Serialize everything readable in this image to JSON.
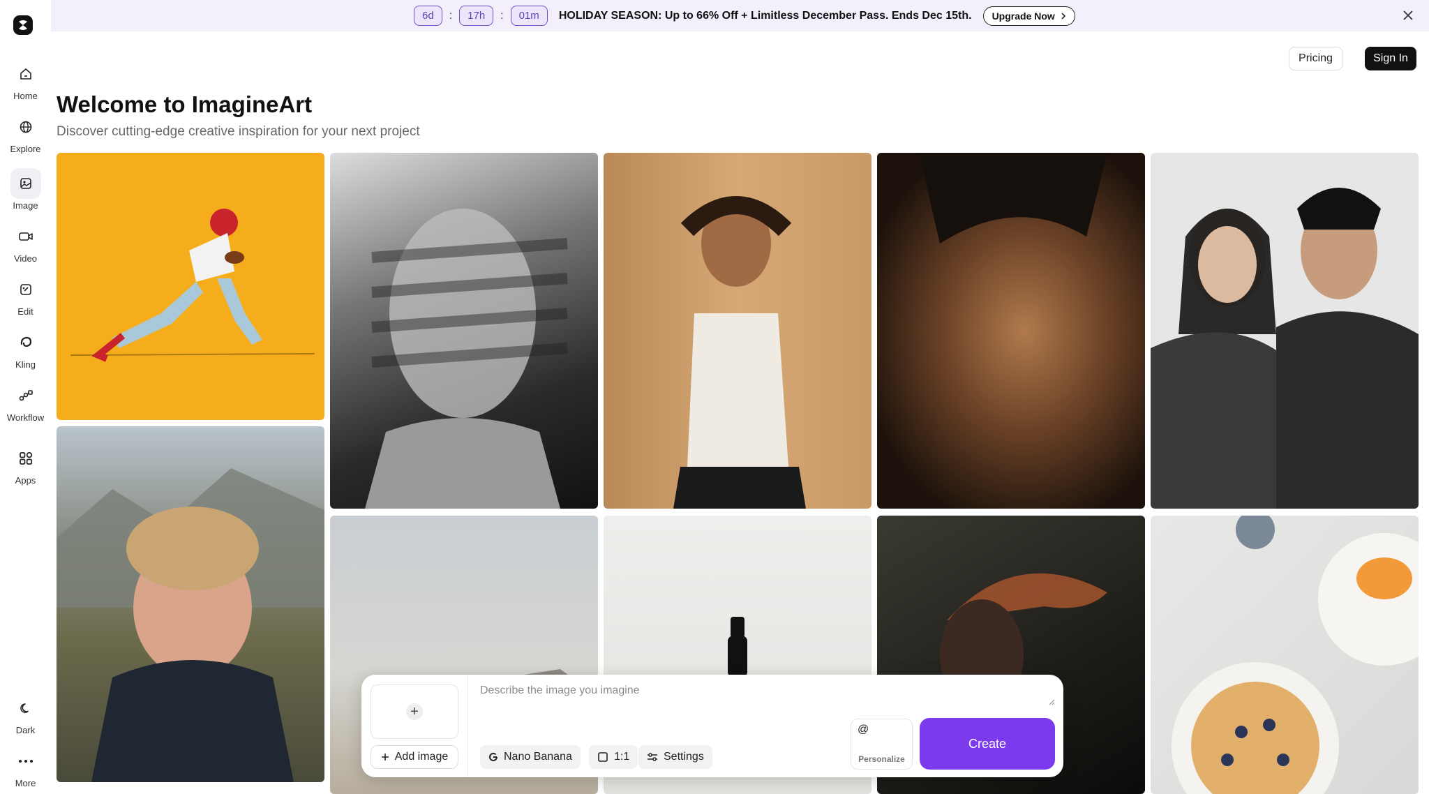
{
  "banner": {
    "countdown": {
      "days": "6d",
      "hours": "17h",
      "minutes": "01m"
    },
    "separator": ":",
    "promo_text": "HOLIDAY SEASON: Up to 66% Off + Limitless December Pass. Ends Dec 15th.",
    "upgrade_label": "Upgrade Now"
  },
  "header": {
    "pricing_label": "Pricing",
    "signin_label": "Sign In"
  },
  "sidebar": {
    "items": [
      {
        "label": "Home",
        "icon": "home-icon"
      },
      {
        "label": "Explore",
        "icon": "globe-icon"
      },
      {
        "label": "Image",
        "icon": "image-icon",
        "active": true
      },
      {
        "label": "Video",
        "icon": "video-icon"
      },
      {
        "label": "Edit",
        "icon": "edit-icon"
      },
      {
        "label": "Kling",
        "icon": "kling-icon"
      },
      {
        "label": "Workflow",
        "icon": "workflow-icon"
      },
      {
        "label": "Apps",
        "icon": "apps-icon"
      }
    ],
    "bottom": [
      {
        "label": "Dark",
        "icon": "moon-icon"
      },
      {
        "label": "More",
        "icon": "more-icon"
      }
    ]
  },
  "main": {
    "title": "Welcome to ImagineArt",
    "subtitle": "Discover cutting-edge creative inspiration for your next project"
  },
  "prompt": {
    "placeholder": "Describe the image you imagine",
    "add_image_label": "Add image",
    "model_label": "Nano Banana",
    "ratio_label": "1:1",
    "settings_label": "Settings",
    "personalize_label": "Personalize",
    "personalize_symbol": "@",
    "create_label": "Create"
  },
  "colors": {
    "accent": "#7c3aed",
    "banner_bg": "#f3f0fc"
  }
}
